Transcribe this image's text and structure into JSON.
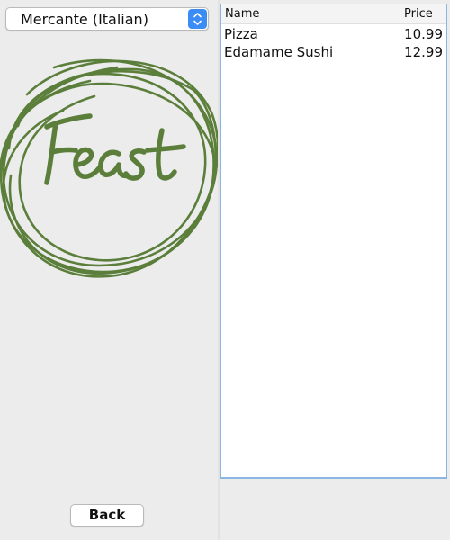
{
  "restaurant_select": {
    "selected": "Mercante (Italian)"
  },
  "logo": {
    "text": "Feast",
    "color": "#5b7f3b"
  },
  "back_button": {
    "label": "Back"
  },
  "menu_table": {
    "columns": [
      "Name",
      "Price"
    ],
    "rows": [
      {
        "name": "Pizza",
        "price": "10.99"
      },
      {
        "name": "Edamame Sushi",
        "price": "12.99"
      }
    ]
  },
  "colors": {
    "accent": "#3c8cf6",
    "table_border": "#8ab6e4",
    "window_bg": "#ececec"
  }
}
